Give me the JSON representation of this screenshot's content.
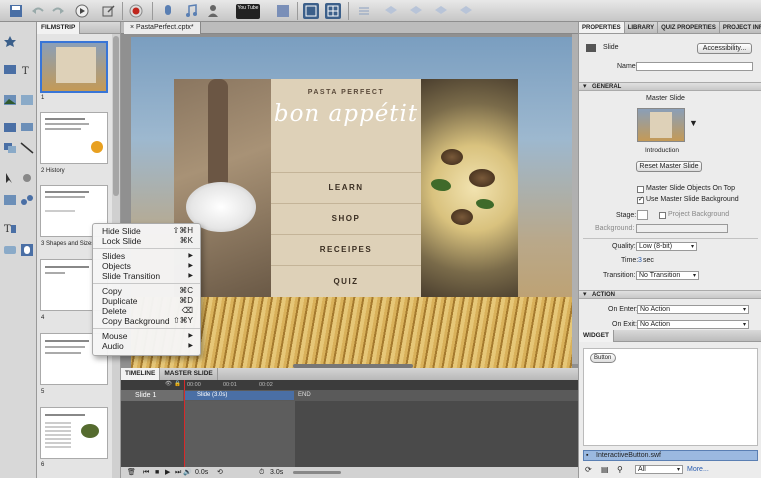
{
  "toolbar": {
    "youtube_label": "You Tube",
    "icons": [
      "save-icon",
      "undo-icon",
      "redo-icon",
      "play-icon",
      "publish-icon",
      "record-icon",
      "microphone-icon",
      "music-icon",
      "export-icon",
      "user-icon",
      "youtube-icon",
      "facebook-icon",
      "layout-icon",
      "grid-icon"
    ]
  },
  "filmstrip": {
    "tab": "FILMSTRIP",
    "slides": [
      {
        "num": "1"
      },
      {
        "num": "2 History"
      },
      {
        "num": "3 Shapes and Sizes"
      },
      {
        "num": "4"
      },
      {
        "num": "5"
      },
      {
        "num": "6"
      }
    ]
  },
  "document": {
    "tab": "PastaPerfect.cptx*"
  },
  "slide": {
    "brand": "PASTA PERFECT",
    "tagline": "bon appétit",
    "items": [
      "LEARN",
      "SHOP",
      "RECEIPES",
      "QUIZ"
    ]
  },
  "context_menu": {
    "items": [
      {
        "label": "Hide Slide",
        "shortcut": "⇧⌘H"
      },
      {
        "label": "Lock Slide",
        "shortcut": "⌘K"
      },
      {
        "sep": true
      },
      {
        "label": "Slides",
        "arrow": "▶"
      },
      {
        "label": "Objects",
        "arrow": "▶"
      },
      {
        "label": "Slide Transition",
        "arrow": "▶"
      },
      {
        "sep": true
      },
      {
        "label": "Copy",
        "shortcut": "⌘C"
      },
      {
        "label": "Duplicate",
        "shortcut": "⌘D"
      },
      {
        "label": "Delete",
        "shortcut": "⌫"
      },
      {
        "label": "Copy Background",
        "shortcut": "⇧⌘Y"
      },
      {
        "sep": true
      },
      {
        "label": "Mouse",
        "arrow": "▶"
      },
      {
        "label": "Audio",
        "arrow": "▶"
      }
    ]
  },
  "timeline": {
    "tabs": [
      "TIMELINE",
      "MASTER SLIDE"
    ],
    "ruler": [
      "00:00",
      "00:01",
      "00:02"
    ],
    "row_label": "Slide 1",
    "bar_label": "Slide (3.0s)",
    "end_label": "END",
    "time_current": "0.0s",
    "time_total": "3.0s"
  },
  "properties": {
    "tabs": [
      "PROPERTIES",
      "LIBRARY",
      "QUIZ PROPERTIES",
      "PROJECT INFO"
    ],
    "type": "Slide",
    "accessibility_button": "Accessibility...",
    "name_label": "Name:",
    "name_value": "",
    "general": {
      "header": "GENERAL",
      "master_slide_label": "Master Slide",
      "master_name": "Introduction",
      "reset_button": "Reset Master Slide",
      "objects_on_top": "Master Slide Objects On Top",
      "use_background": "Use Master Slide Background",
      "stage_label": "Stage:",
      "project_background": "Project Background",
      "background_label": "Background:",
      "quality_label": "Quality:",
      "quality_value": "Low (8-bit)",
      "time_label": "Time:",
      "time_value": "3",
      "time_unit": "sec",
      "transition_label": "Transition:",
      "transition_value": "No Transition"
    },
    "action": {
      "header": "ACTION",
      "on_enter_label": "On Enter:",
      "on_enter_value": "No Action",
      "on_exit_label": "On Exit:",
      "on_exit_value": "No Action"
    }
  },
  "widget": {
    "tab": "WIDGET",
    "preview_button": "Button",
    "selected_file": "InteractiveButton.swf",
    "filter_value": "All",
    "more_link": "More..."
  }
}
